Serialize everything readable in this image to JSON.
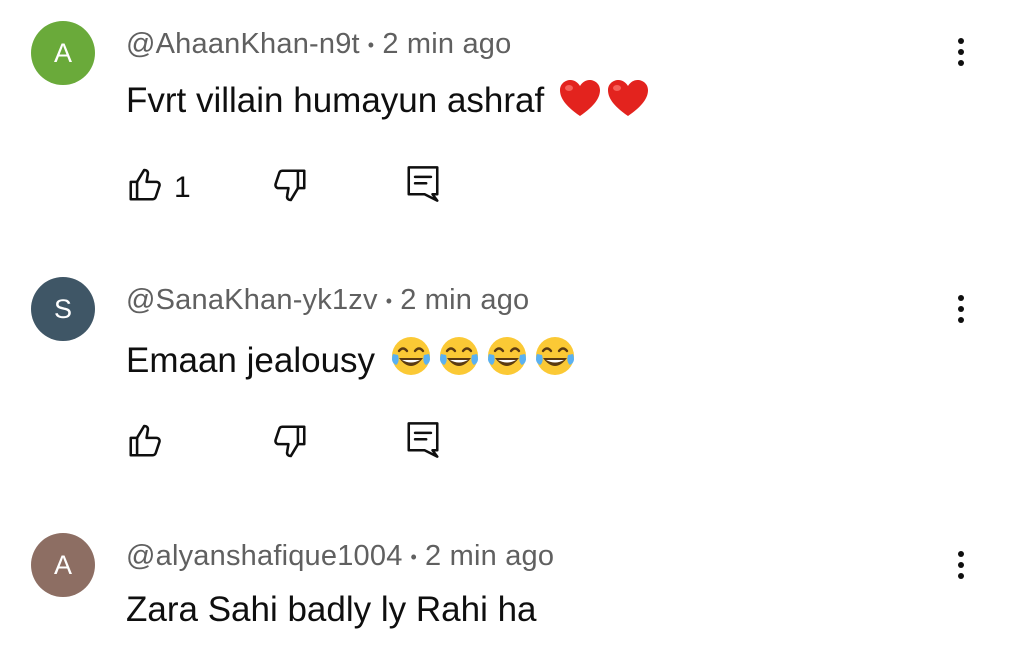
{
  "comments": [
    {
      "avatar_letter": "A",
      "avatar_color": "#6aaa3a",
      "author": "@AhaanKhan-n9t",
      "separator": "•",
      "time": "2 min ago",
      "text": "Fvrt villain humayun ashraf",
      "emojis": [
        "red-heart",
        "red-heart"
      ],
      "like_count": "1"
    },
    {
      "avatar_letter": "S",
      "avatar_color": "#3f5666",
      "author": "@SanaKhan-yk1zv",
      "separator": "•",
      "time": "2 min ago",
      "text": "Emaan jealousy",
      "emojis": [
        "tears-of-joy",
        "tears-of-joy",
        "tears-of-joy",
        "tears-of-joy"
      ],
      "like_count": ""
    },
    {
      "avatar_letter": "A",
      "avatar_color": "#8d6e63",
      "author": "@alyanshafique1004",
      "separator": "•",
      "time": "2 min ago",
      "text": "Zara Sahi badly ly Rahi ha",
      "emojis": [],
      "like_count": ""
    }
  ],
  "icons": {
    "like": "thumbs-up-icon",
    "dislike": "thumbs-down-icon",
    "reply": "reply-icon",
    "menu": "more-vert-icon"
  }
}
